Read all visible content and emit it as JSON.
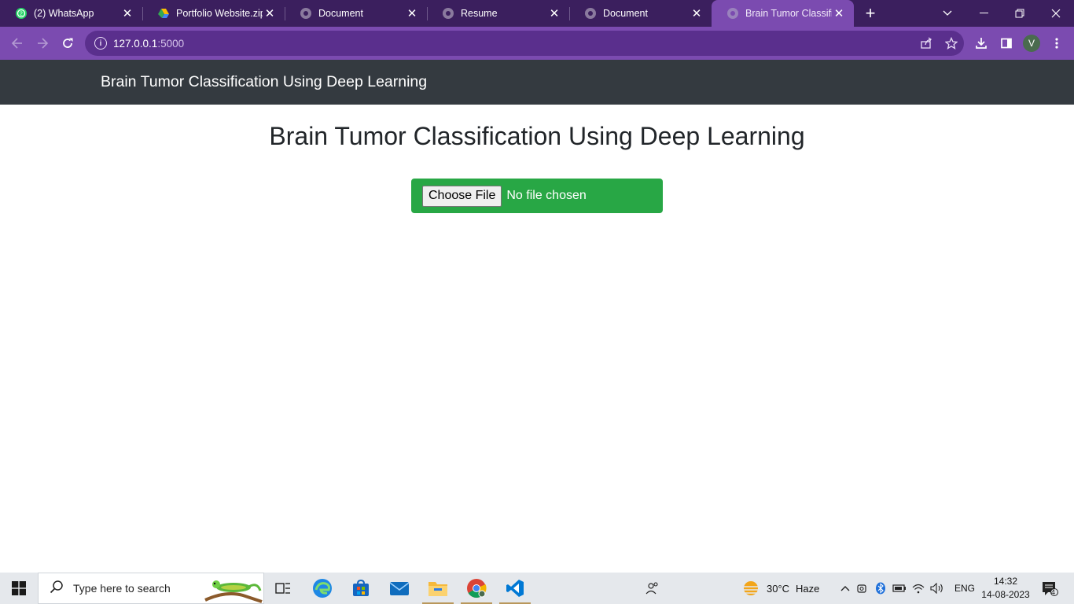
{
  "browser": {
    "tabs": [
      {
        "title": "(2) WhatsApp",
        "icon": "whatsapp-icon"
      },
      {
        "title": "Portfolio Website.zip -",
        "icon": "google-drive-icon"
      },
      {
        "title": "Document",
        "icon": "globe-icon"
      },
      {
        "title": "Resume",
        "icon": "globe-icon"
      },
      {
        "title": "Document",
        "icon": "globe-icon"
      },
      {
        "title": "Brain Tumor Classifica",
        "icon": "globe-icon",
        "active": true
      }
    ],
    "address": {
      "host": "127.0.0.1",
      "port": ":5000"
    },
    "profile_initial": "V",
    "colors": {
      "frame": "#3b1f5e",
      "toolbar": "#7b4bb0",
      "omnibox": "#5a2f8d"
    }
  },
  "page": {
    "navbar_brand": "Brain Tumor Classification Using Deep Learning",
    "heading": "Brain Tumor Classification Using Deep Learning",
    "upload": {
      "button_label": "Choose File",
      "status": "No file chosen"
    },
    "colors": {
      "navbar": "#343a40",
      "upload_bg": "#28a745"
    }
  },
  "taskbar": {
    "search_placeholder": "Type here to search",
    "apps": [
      "task-view-icon",
      "edge-icon",
      "store-icon",
      "mail-icon",
      "file-explorer-icon",
      "chrome-icon",
      "vscode-icon"
    ],
    "weather": {
      "temp": "30°C",
      "condition": "Haze"
    },
    "language": "ENG",
    "time": "14:32",
    "date": "14-08-2023",
    "notifications": "4"
  }
}
